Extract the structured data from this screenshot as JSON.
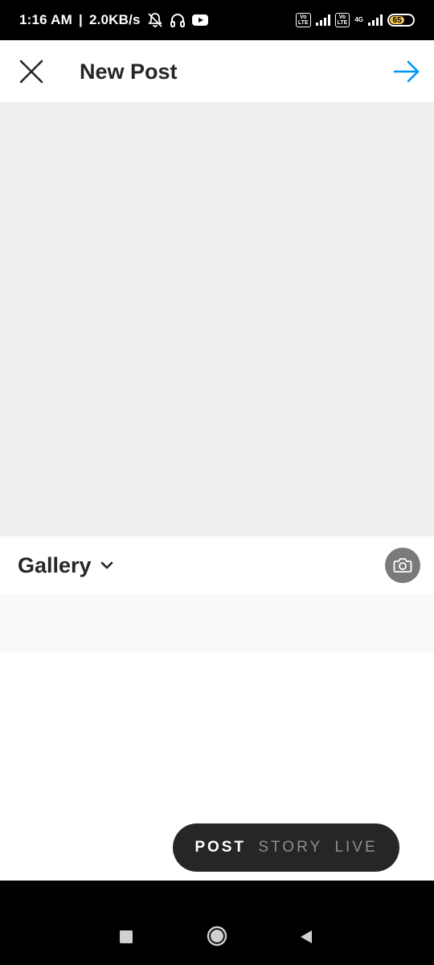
{
  "status_bar": {
    "time": "1:16 AM",
    "network_speed": "2.0KB/s",
    "icons": [
      "mute-bell-icon",
      "headphones-icon",
      "youtube-icon"
    ],
    "volte_label_1": "Vo LTE",
    "volte_label_2": "Vo LTE",
    "net_label": "4G",
    "battery_level": "65",
    "battery_color": "#f3c24b"
  },
  "app_bar": {
    "title": "New Post",
    "close_icon": "close-icon",
    "next_icon": "arrow-right-icon",
    "accent_color": "#0095f6"
  },
  "gallery": {
    "label": "Gallery",
    "dropdown_icon": "chevron-down-icon",
    "camera_icon": "camera-icon"
  },
  "modes": {
    "items": [
      "POST",
      "STORY",
      "LIVE"
    ],
    "active": "POST"
  },
  "nav_bar": {
    "icons": [
      "recent-apps-icon",
      "home-icon",
      "back-icon"
    ]
  }
}
